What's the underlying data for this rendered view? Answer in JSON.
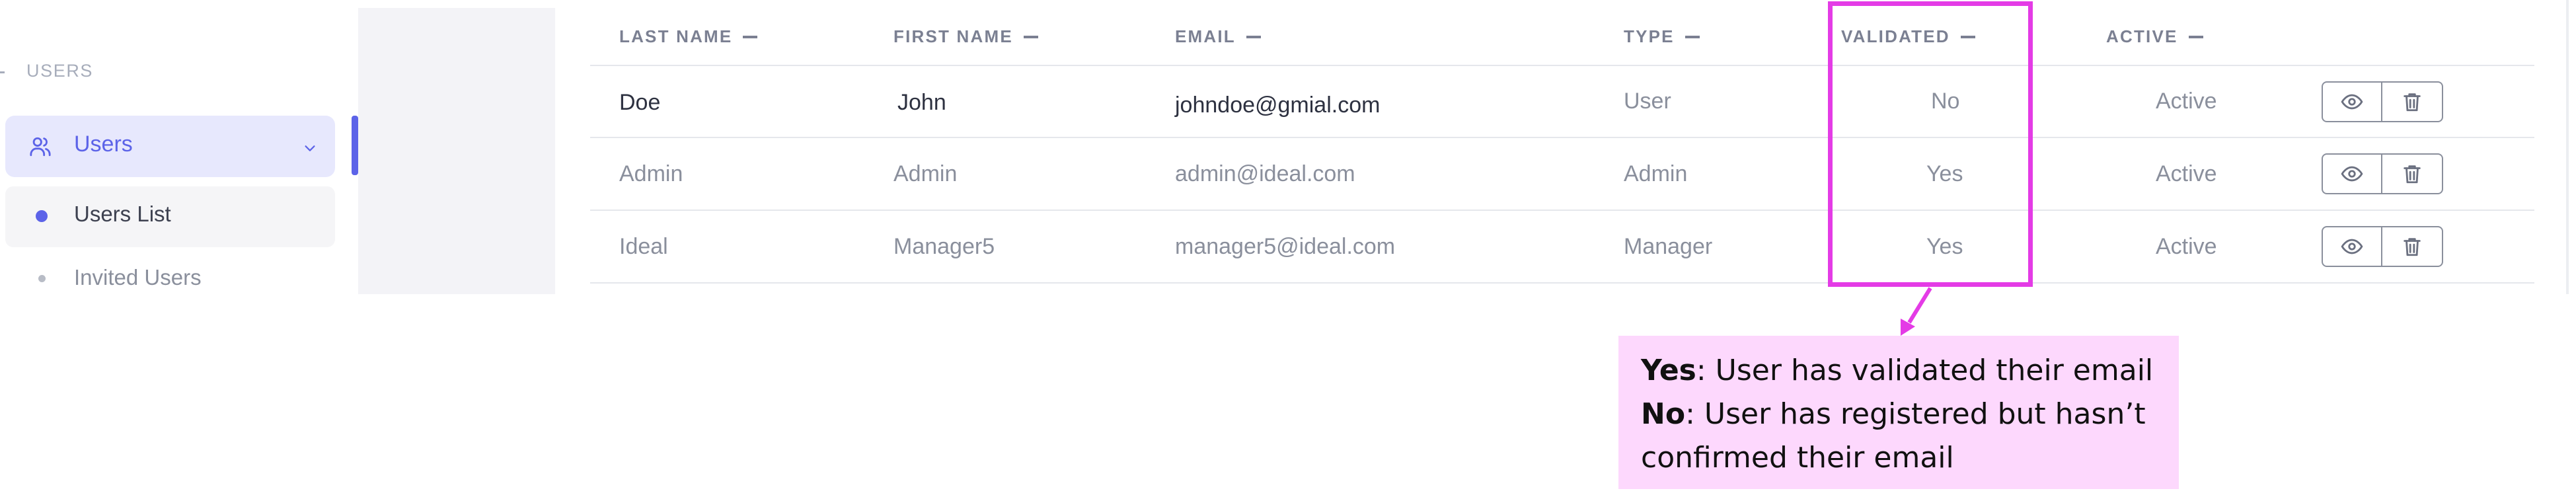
{
  "sidebar": {
    "section_title": "USERS",
    "nav_item": {
      "label": "Users",
      "icon": "users-icon"
    },
    "sub_items": [
      {
        "label": "Users List",
        "active": true
      },
      {
        "label": "Invited Users",
        "active": false
      }
    ]
  },
  "table": {
    "headers": [
      "LAST NAME",
      "FIRST NAME",
      "EMAIL",
      "TYPE",
      "VALIDATED",
      "ACTIVE"
    ],
    "rows": [
      {
        "last": "Doe",
        "first": "John",
        "email": "johndoe@gmial.com",
        "type": "User",
        "validated": "No",
        "active": "Active"
      },
      {
        "last": "Admin",
        "first": "Admin",
        "email": "admin@ideal.com",
        "type": "Admin",
        "validated": "Yes",
        "active": "Active"
      },
      {
        "last": "Ideal",
        "first": "Manager5",
        "email": "manager5@ideal.com",
        "type": "Manager",
        "validated": "Yes",
        "active": "Active"
      }
    ],
    "action_icons": [
      "eye-icon",
      "trash-icon"
    ]
  },
  "annotation": {
    "yes_term": "Yes",
    "yes_text": ": User has validated their email",
    "no_term": "No",
    "no_text": ": User has registered but hasn’t confirmed their email"
  },
  "colors": {
    "accent": "#5c63e8",
    "nav_active_bg": "#e7e8fd",
    "highlight": "#e43be6",
    "callout_bg": "#fdd8fd",
    "muted_text": "#8a8f9c"
  }
}
